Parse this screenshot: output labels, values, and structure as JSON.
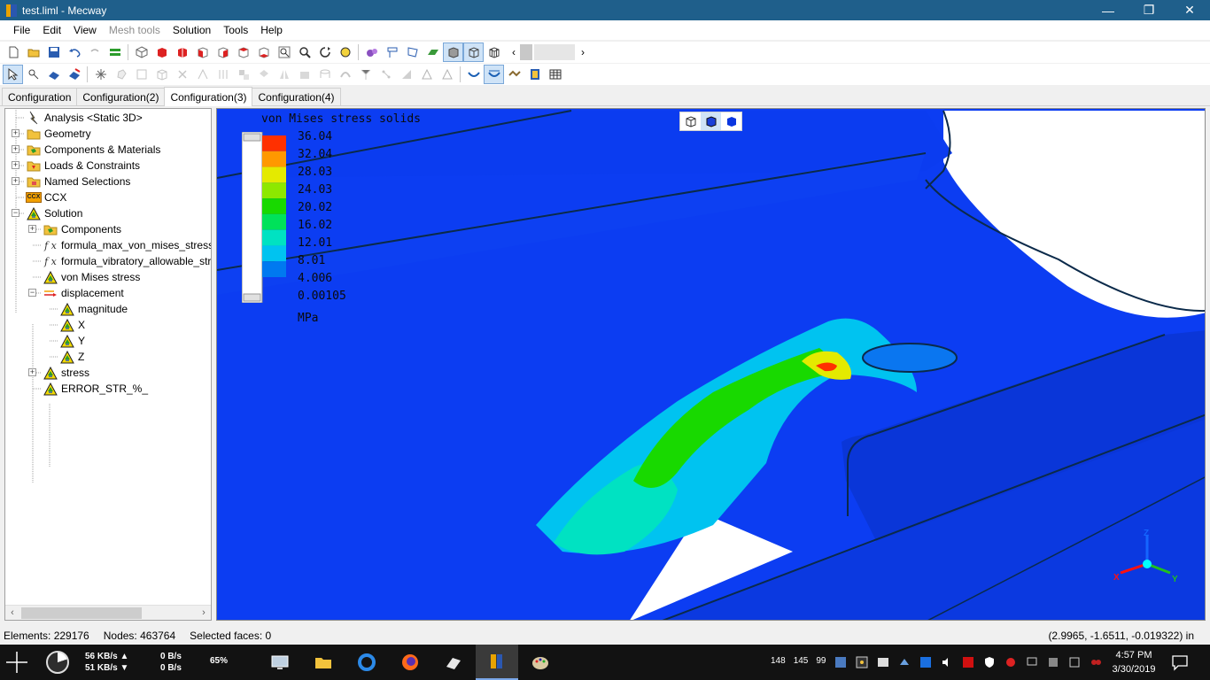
{
  "window": {
    "title": "test.liml - Mecway",
    "controls": {
      "minimize": "—",
      "maximize": "❐",
      "close": "✕"
    }
  },
  "menu": {
    "items": [
      "File",
      "Edit",
      "View",
      "Mesh tools",
      "Solution",
      "Tools",
      "Help"
    ],
    "disabled": [
      "Mesh tools"
    ]
  },
  "toolbar": {
    "scroll_left": "‹",
    "scroll_right": "›"
  },
  "tabs": [
    {
      "label": "Configuration",
      "active": false
    },
    {
      "label": "Configuration(2)",
      "active": false
    },
    {
      "label": "Configuration(3)",
      "active": true
    },
    {
      "label": "Configuration(4)",
      "active": false
    }
  ],
  "tree": {
    "nodes": [
      {
        "label": "Analysis <Static 3D>",
        "icon": "analysis-icon",
        "level": 1,
        "expander": ""
      },
      {
        "label": "Geometry",
        "icon": "folder-icon",
        "level": 1,
        "expander": "+"
      },
      {
        "label": "Components & Materials",
        "icon": "components-icon",
        "level": 1,
        "expander": "+"
      },
      {
        "label": "Loads & Constraints",
        "icon": "loads-icon",
        "level": 1,
        "expander": "+"
      },
      {
        "label": "Named Selections",
        "icon": "named-selection-icon",
        "level": 1,
        "expander": "+"
      },
      {
        "label": "CCX",
        "icon": "ccx-icon",
        "level": 1,
        "expander": "",
        "icon_text": "CCX"
      },
      {
        "label": "Solution",
        "icon": "warning-triangle-icon",
        "level": 1,
        "expander": "−"
      },
      {
        "label": "Components",
        "icon": "components-icon",
        "level": 2,
        "expander": "+"
      },
      {
        "label": "formula_max_von_mises_stress_",
        "icon": "formula-icon",
        "level": 2,
        "expander": "",
        "icon_text": "f x"
      },
      {
        "label": "formula_vibratory_allowable_str",
        "icon": "formula-icon",
        "level": 2,
        "expander": "",
        "icon_text": "f x"
      },
      {
        "label": "von Mises stress",
        "icon": "warning-triangle-icon",
        "level": 2,
        "expander": ""
      },
      {
        "label": "displacement",
        "icon": "displacement-icon",
        "level": 2,
        "expander": "−"
      },
      {
        "label": "magnitude",
        "icon": "warning-triangle-icon",
        "level": 3,
        "expander": ""
      },
      {
        "label": "X",
        "icon": "warning-triangle-icon",
        "level": 3,
        "expander": ""
      },
      {
        "label": "Y",
        "icon": "warning-triangle-icon",
        "level": 3,
        "expander": ""
      },
      {
        "label": "Z",
        "icon": "warning-triangle-icon",
        "level": 3,
        "expander": ""
      },
      {
        "label": "stress",
        "icon": "warning-triangle-icon",
        "level": 2,
        "expander": "+"
      },
      {
        "label": "ERROR_STR_%_",
        "icon": "warning-triangle-icon",
        "level": 2,
        "expander": ""
      }
    ],
    "scroll_left": "‹",
    "scroll_right": "›"
  },
  "legend": {
    "title": "von Mises stress solids",
    "values": [
      "36.04",
      "32.04",
      "28.03",
      "24.03",
      "20.02",
      "16.02",
      "12.01",
      "8.01",
      "4.006",
      "0.00105"
    ],
    "unit": "MPa",
    "colors": [
      "#ff3000",
      "#ff9800",
      "#e4ea00",
      "#8de800",
      "#18d900",
      "#00e25a",
      "#00e2c2",
      "#00c3f0",
      "#0079f0",
      "#0c3df2"
    ]
  },
  "triad": {
    "x": "X",
    "y": "Y",
    "z": "Z"
  },
  "status": {
    "elements": "Elements: 229176",
    "nodes": "Nodes: 463764",
    "selected": "Selected faces: 0",
    "coords": "(2.9965, -1.6511, -0.019322) in"
  },
  "taskbar": {
    "net_up": "56 KB/s ▲",
    "net_down": "51 KB/s ▼",
    "disk_read": "0 B/s",
    "disk_write": "0 B/s",
    "cpu": "65%",
    "tray_numbers": [
      "148",
      "145",
      "99"
    ],
    "time": "4:57 PM",
    "date": "3/30/2019"
  },
  "colors": {
    "titlebar": "#1f5f8b",
    "mesh_blue": "#0c3df2",
    "background_white": "#ffffff"
  }
}
